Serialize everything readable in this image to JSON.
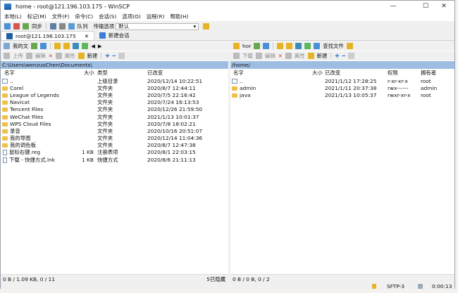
{
  "window": {
    "title": "home - root@121.196.103.175 - WinSCP",
    "minimize": "—",
    "maximize": "☐",
    "close": "✕"
  },
  "menu": [
    "本地(L)",
    "标记(M)",
    "文件(F)",
    "命令(C)",
    "会话(S)",
    "选项(O)",
    "远程(R)",
    "帮助(H)"
  ],
  "toolbar": {
    "sync": "同步",
    "queue": "队列",
    "transfer_label": "传输选项",
    "transfer_value": "默认"
  },
  "tabs": {
    "session": "root@121.196.103.175",
    "close": "✕",
    "new_session": "新建会话"
  },
  "left": {
    "location": "我的文",
    "upload": "上传",
    "edit": "编辑",
    "props": "属性",
    "new": "新建",
    "path": "C:\\Users\\wenzuoChen\\Documents\\",
    "headers": {
      "name": "名字",
      "size": "大小",
      "type": "类型",
      "changed": "已改变"
    },
    "rows": [
      {
        "kind": "up",
        "name": "..",
        "size": "",
        "type": "上级目录",
        "changed": "2020/12/14  10:22:51"
      },
      {
        "kind": "folder",
        "name": "Corel",
        "size": "",
        "type": "文件夹",
        "changed": "2020/8/7  12:44:11"
      },
      {
        "kind": "folder",
        "name": "League of Legends",
        "size": "",
        "type": "文件夹",
        "changed": "2020/7/5  22:16:42"
      },
      {
        "kind": "folder",
        "name": "Navicat",
        "size": "",
        "type": "文件夹",
        "changed": "2020/7/24  16:13:53"
      },
      {
        "kind": "folder",
        "name": "Tencent Files",
        "size": "",
        "type": "文件夹",
        "changed": "2020/12/26  21:59:50"
      },
      {
        "kind": "folder",
        "name": "WeChat Files",
        "size": "",
        "type": "文件夹",
        "changed": "2021/1/13  10:01:37"
      },
      {
        "kind": "folder",
        "name": "WPS Cloud Files",
        "size": "",
        "type": "文件夹",
        "changed": "2020/7/8  18:02:21"
      },
      {
        "kind": "folder",
        "name": "录音",
        "size": "",
        "type": "文件夹",
        "changed": "2020/10/16  20:51:07"
      },
      {
        "kind": "folder",
        "name": "我的导图",
        "size": "",
        "type": "文件夹",
        "changed": "2020/12/14  11:04:36"
      },
      {
        "kind": "folder",
        "name": "我的调色板",
        "size": "",
        "type": "文件夹",
        "changed": "2020/8/7  12:47:38"
      },
      {
        "kind": "file",
        "name": "鼠标右键.reg",
        "size": "1 KB",
        "type": "注册表项",
        "changed": "2020/8/1  22:03:15"
      },
      {
        "kind": "file",
        "name": "下载 - 快捷方式.lnk",
        "size": "1 KB",
        "type": "快捷方式",
        "changed": "2020/8/6  21:11:13"
      }
    ],
    "status_left": "0 B / 1.09 KB,   0 / 11",
    "status_right": "5已隐藏"
  },
  "right": {
    "location": "hor",
    "find": "查找文件",
    "download": "下载",
    "edit": "编辑",
    "props": "属性",
    "new": "新建",
    "path": "/home/",
    "headers": {
      "name": "名字",
      "size": "大小",
      "changed": "已改变",
      "rights": "权限",
      "owner": "拥有者"
    },
    "rows": [
      {
        "kind": "up",
        "name": "..",
        "size": "",
        "changed": "2021/1/12  17:28:25",
        "rights": "r-xr-xr-x",
        "owner": "root"
      },
      {
        "kind": "folder",
        "name": "admin",
        "size": "",
        "changed": "2021/1/11  20:37:38",
        "rights": "rwx------",
        "owner": "admin"
      },
      {
        "kind": "folder",
        "name": "java",
        "size": "",
        "changed": "2021/1/13  10:05:37",
        "rights": "rwxr-xr-x",
        "owner": "root"
      }
    ],
    "status_left": "0 B / 0 B,   0 / 2"
  },
  "bottom": {
    "protocol": "SFTP-3",
    "time": "0:00:13"
  }
}
